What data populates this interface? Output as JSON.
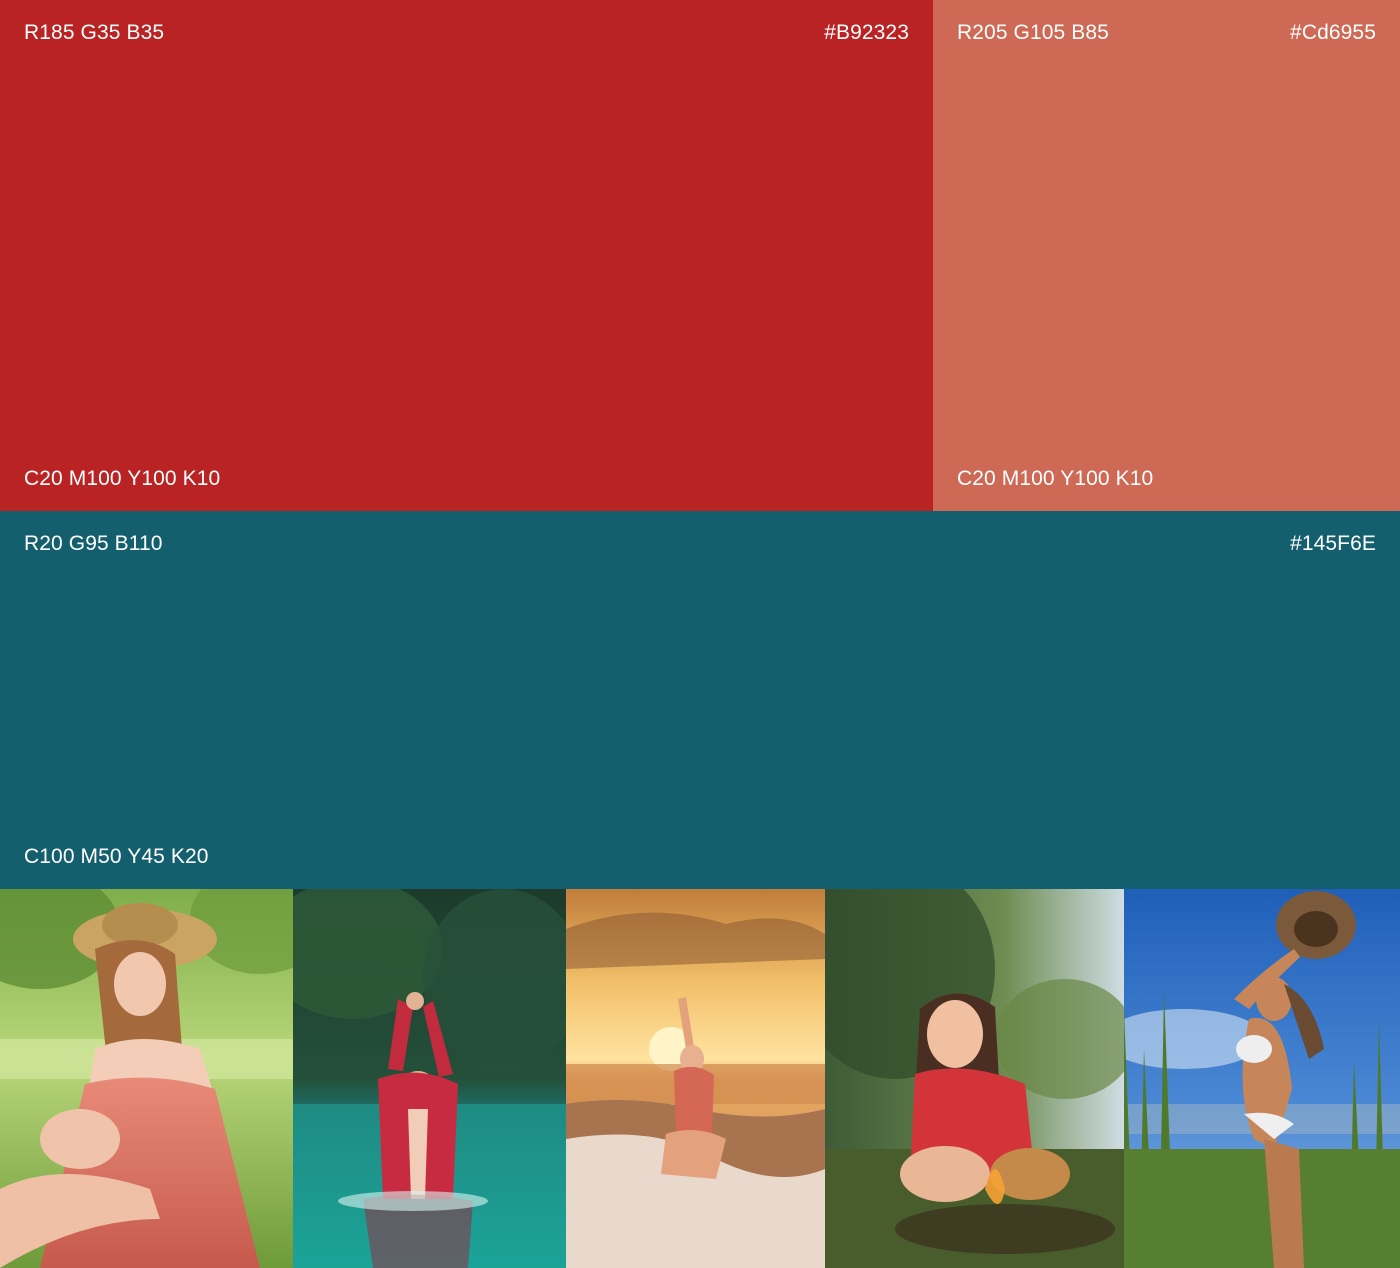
{
  "swatches": [
    {
      "id": "red",
      "color": "#B92323",
      "rgb": "R185 G35 B35",
      "hex": "#B92323",
      "cmyk": "C20 M100 Y100 K10"
    },
    {
      "id": "coral",
      "color": "#CD6955",
      "rgb": "R205 G105 B85",
      "hex": "#Cd6955",
      "cmyk": "C20 M100 Y100 K10"
    },
    {
      "id": "teal",
      "color": "#145F6E",
      "rgb": "R20 G95 B110",
      "hex": "#145F6E",
      "cmyk": "C100 M50 Y45 K20"
    }
  ],
  "photos": [
    {
      "icon": "photo-woman-straw-hat-pink-dress"
    },
    {
      "icon": "photo-woman-in-water-red-shirt"
    },
    {
      "icon": "photo-woman-beach-sunset"
    },
    {
      "icon": "photo-woman-forest-red-shirt"
    },
    {
      "icon": "photo-woman-grass-sky-hat"
    }
  ]
}
